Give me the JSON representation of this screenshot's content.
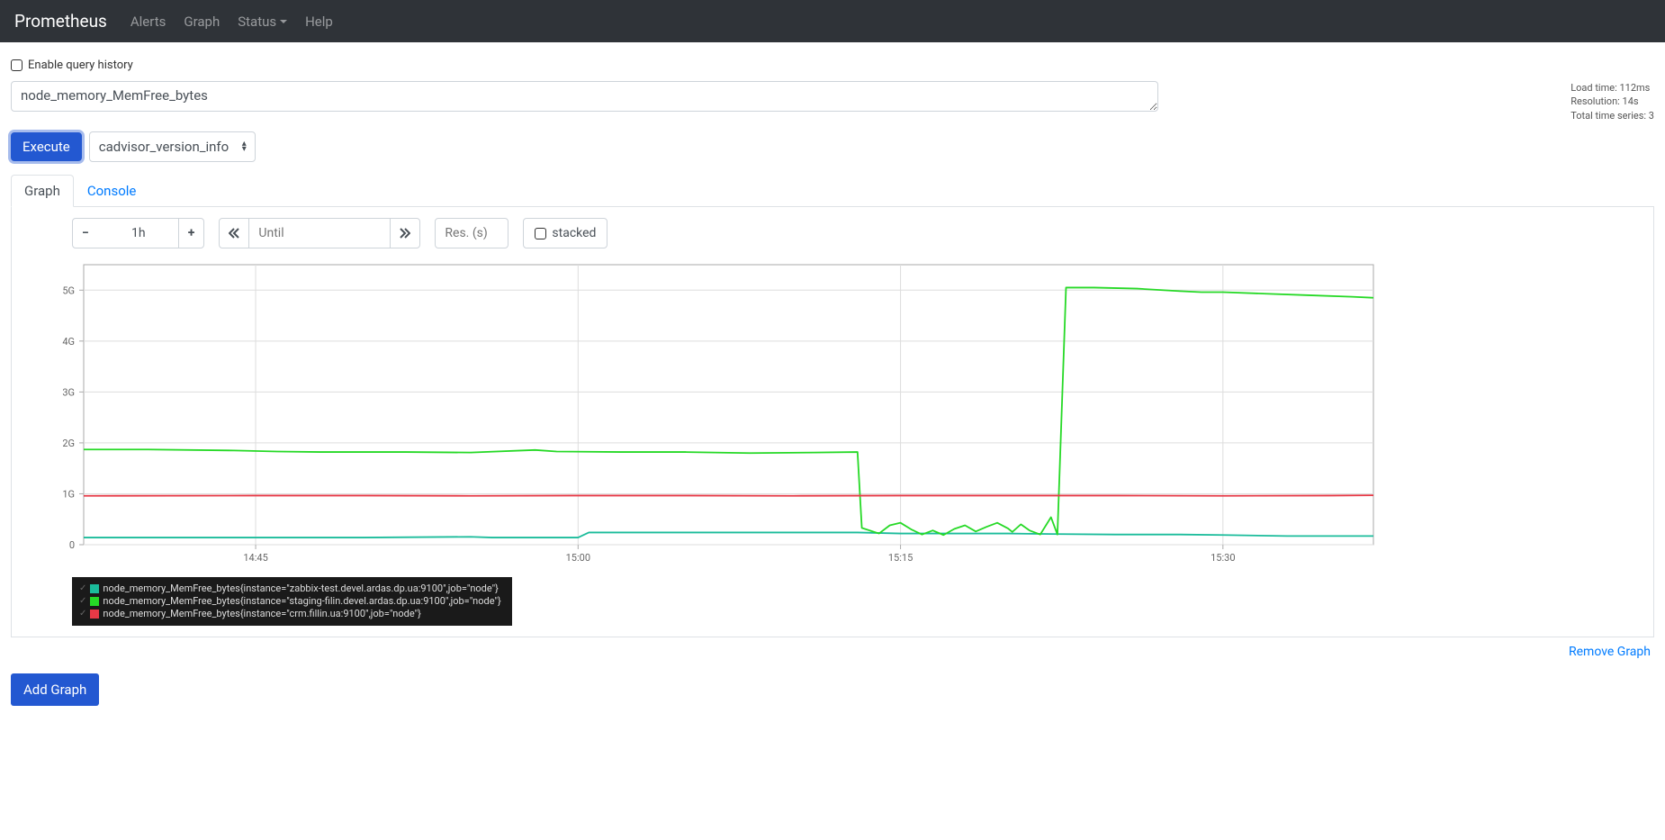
{
  "nav": {
    "brand": "Prometheus",
    "items": [
      "Alerts",
      "Graph",
      "Status",
      "Help"
    ]
  },
  "history_label": "Enable query history",
  "query": {
    "expression": "node_memory_MemFree_bytes",
    "stats": {
      "load": "Load time: 112ms",
      "resolution": "Resolution: 14s",
      "series": "Total time series: 3"
    },
    "execute_label": "Execute",
    "metric_select": "cadvisor_version_info"
  },
  "tabs": {
    "graph": "Graph",
    "console": "Console"
  },
  "controls": {
    "range": "1h",
    "until_placeholder": "Until",
    "res_placeholder": "Res. (s)",
    "stacked_label": "stacked"
  },
  "footer": {
    "remove": "Remove Graph",
    "add": "Add Graph"
  },
  "legend": [
    {
      "color": "#1bbc9b",
      "label": "node_memory_MemFree_bytes{instance=\"zabbix-test.devel.ardas.dp.ua:9100\",job=\"node\"}"
    },
    {
      "color": "#26d926",
      "label": "node_memory_MemFree_bytes{instance=\"staging-filin.devel.ardas.dp.ua:9100\",job=\"node\"}"
    },
    {
      "color": "#e63946",
      "label": "node_memory_MemFree_bytes{instance=\"crm.fillin.ua:9100\",job=\"node\"}"
    }
  ],
  "chart_data": {
    "type": "line",
    "xlabel": "",
    "ylabel": "",
    "x_ticks": [
      "14:45",
      "15:00",
      "15:15",
      "15:30"
    ],
    "y_ticks": [
      "0",
      "1G",
      "2G",
      "3G",
      "4G",
      "5G"
    ],
    "ymax_bytes": 5500000000,
    "x_range_minutes": [
      37,
      97
    ],
    "series": [
      {
        "name": "zabbix-test",
        "color": "#1bbc9b",
        "points": [
          [
            37,
            140000000
          ],
          [
            45,
            140000000
          ],
          [
            50,
            140000000
          ],
          [
            55,
            155000000
          ],
          [
            56,
            140000000
          ],
          [
            60,
            140000000
          ],
          [
            60.5,
            240000000
          ],
          [
            65,
            240000000
          ],
          [
            70,
            240000000
          ],
          [
            73,
            240000000
          ],
          [
            75,
            220000000
          ],
          [
            78,
            220000000
          ],
          [
            80,
            220000000
          ],
          [
            82,
            210000000
          ],
          [
            85,
            200000000
          ],
          [
            88,
            200000000
          ],
          [
            90,
            190000000
          ],
          [
            93,
            170000000
          ],
          [
            95,
            170000000
          ],
          [
            97,
            170000000
          ]
        ]
      },
      {
        "name": "staging-filin",
        "color": "#26d926",
        "points": [
          [
            37,
            1870000000
          ],
          [
            40,
            1870000000
          ],
          [
            44,
            1850000000
          ],
          [
            46,
            1830000000
          ],
          [
            48,
            1820000000
          ],
          [
            52,
            1820000000
          ],
          [
            55,
            1810000000
          ],
          [
            58,
            1860000000
          ],
          [
            59,
            1830000000
          ],
          [
            62,
            1820000000
          ],
          [
            65,
            1820000000
          ],
          [
            68,
            1800000000
          ],
          [
            71,
            1810000000
          ],
          [
            73,
            1820000000
          ],
          [
            73.2,
            330000000
          ],
          [
            74,
            220000000
          ],
          [
            74.5,
            380000000
          ],
          [
            75,
            430000000
          ],
          [
            75.5,
            300000000
          ],
          [
            76,
            200000000
          ],
          [
            76.5,
            280000000
          ],
          [
            77,
            190000000
          ],
          [
            77.5,
            310000000
          ],
          [
            78,
            380000000
          ],
          [
            78.5,
            260000000
          ],
          [
            79,
            350000000
          ],
          [
            79.5,
            430000000
          ],
          [
            80,
            320000000
          ],
          [
            80.2,
            250000000
          ],
          [
            80.6,
            400000000
          ],
          [
            81,
            280000000
          ],
          [
            81.5,
            200000000
          ],
          [
            82,
            540000000
          ],
          [
            82.3,
            200000000
          ],
          [
            82.7,
            5050000000
          ],
          [
            84,
            5050000000
          ],
          [
            86,
            5030000000
          ],
          [
            88,
            4980000000
          ],
          [
            89,
            4960000000
          ],
          [
            90,
            4960000000
          ],
          [
            92,
            4930000000
          ],
          [
            94,
            4900000000
          ],
          [
            96,
            4870000000
          ],
          [
            97,
            4850000000
          ]
        ]
      },
      {
        "name": "crm",
        "color": "#e63946",
        "points": [
          [
            37,
            960000000
          ],
          [
            45,
            965000000
          ],
          [
            50,
            965000000
          ],
          [
            55,
            960000000
          ],
          [
            60,
            965000000
          ],
          [
            65,
            965000000
          ],
          [
            70,
            960000000
          ],
          [
            75,
            965000000
          ],
          [
            80,
            965000000
          ],
          [
            85,
            965000000
          ],
          [
            90,
            960000000
          ],
          [
            95,
            965000000
          ],
          [
            97,
            970000000
          ]
        ]
      }
    ]
  }
}
